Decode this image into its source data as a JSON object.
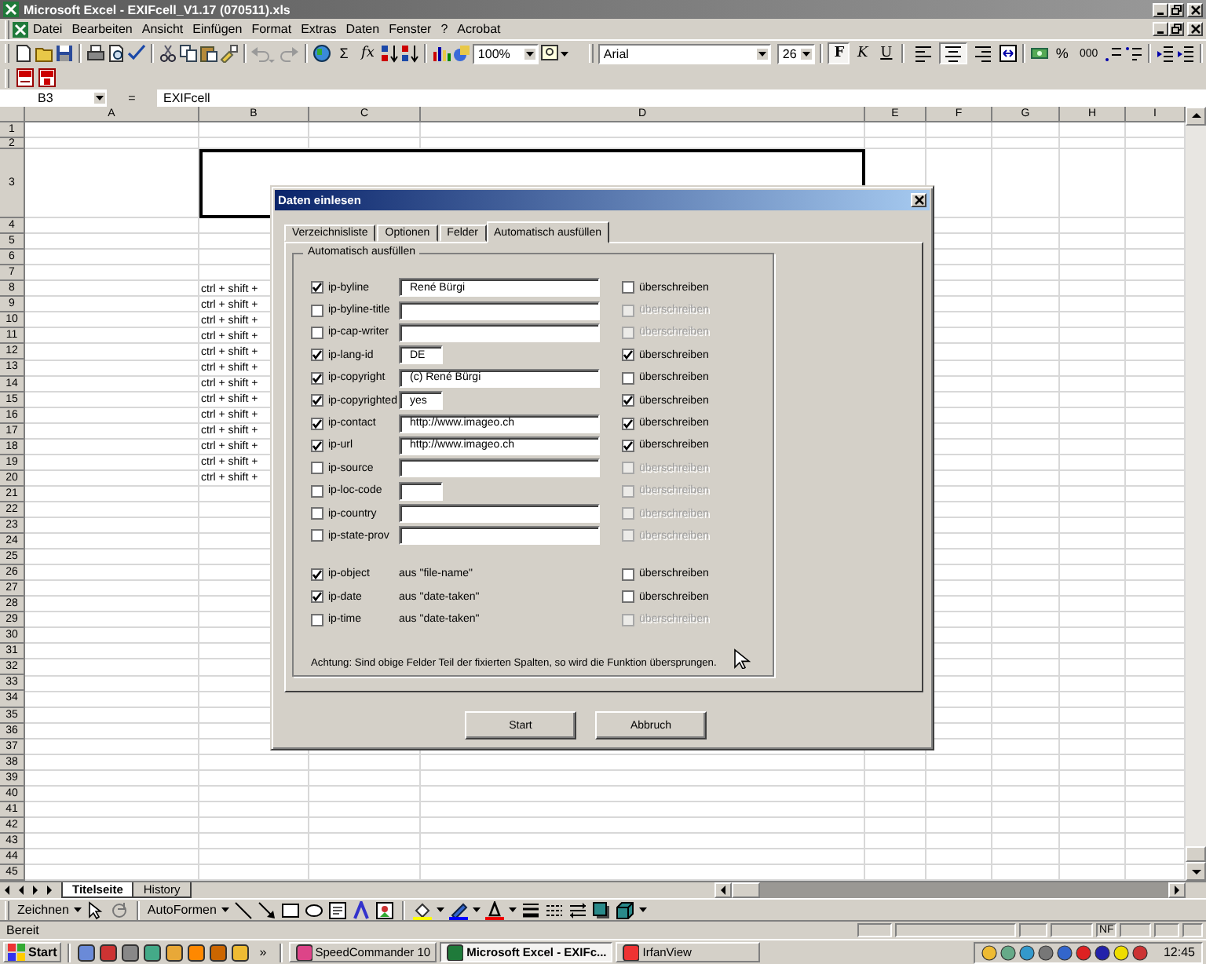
{
  "window": {
    "title": "Microsoft Excel - EXIFcell_V1.17 (070511).xls"
  },
  "menu": [
    "Datei",
    "Bearbeiten",
    "Ansicht",
    "Einfügen",
    "Format",
    "Extras",
    "Daten",
    "Fenster",
    "?",
    "Acrobat"
  ],
  "standard_toolbar": {
    "sum": "Σ",
    "function": "fx",
    "zoom": "100%"
  },
  "formatting_toolbar": {
    "font": "Arial",
    "size": "26",
    "buttons": [
      {
        "label": "F",
        "kind": "bold",
        "pressed": true
      },
      {
        "label": "K",
        "kind": "italic",
        "pressed": false
      },
      {
        "label": "U",
        "kind": "underline",
        "pressed": false
      }
    ],
    "alignment": [
      {
        "kind": "left",
        "pressed": false
      },
      {
        "kind": "center",
        "pressed": true
      },
      {
        "kind": "right",
        "pressed": false
      }
    ],
    "percent": "%",
    "thousands": "000"
  },
  "formula_bar": {
    "name_box": "B3",
    "equals": "=",
    "content": "EXIFcell"
  },
  "columns": [
    "A",
    "B",
    "C",
    "D",
    "E",
    "F",
    "G",
    "H",
    "I"
  ],
  "rows": [
    {
      "label": "1",
      "kind": "normal"
    },
    {
      "label": "2",
      "kind": "short"
    },
    {
      "label": "3",
      "kind": "title"
    },
    {
      "label": "4",
      "kind": "normal"
    },
    {
      "label": "5",
      "kind": "normal"
    },
    {
      "label": "6",
      "kind": "normal"
    },
    {
      "label": "7",
      "kind": "normal"
    },
    {
      "label": "8",
      "kind": "normal",
      "b": "ctrl + shift +"
    },
    {
      "label": "9",
      "kind": "normal",
      "b": "ctrl + shift +"
    },
    {
      "label": "10",
      "kind": "normal",
      "b": "ctrl + shift +"
    },
    {
      "label": "11",
      "kind": "normal",
      "b": "ctrl + shift +"
    },
    {
      "label": "12",
      "kind": "normal",
      "b": "ctrl + shift +"
    },
    {
      "label": "13",
      "kind": "normal",
      "b": "ctrl + shift +"
    },
    {
      "label": "14",
      "kind": "normal",
      "b": "ctrl + shift +"
    },
    {
      "label": "15",
      "kind": "normal",
      "b": "ctrl + shift +"
    },
    {
      "label": "16",
      "kind": "normal",
      "b": "ctrl + shift +"
    },
    {
      "label": "17",
      "kind": "normal",
      "b": "ctrl + shift +"
    },
    {
      "label": "18",
      "kind": "normal",
      "b": "ctrl + shift +"
    },
    {
      "label": "19",
      "kind": "normal",
      "b": "ctrl + shift +"
    },
    {
      "label": "20",
      "kind": "normal",
      "b": "ctrl + shift +"
    },
    {
      "label": "21",
      "kind": "normal"
    },
    {
      "label": "22",
      "kind": "normal"
    },
    {
      "label": "23",
      "kind": "normal"
    },
    {
      "label": "24",
      "kind": "normal"
    },
    {
      "label": "25",
      "kind": "normal"
    },
    {
      "label": "26",
      "kind": "normal"
    },
    {
      "label": "27",
      "kind": "normal"
    },
    {
      "label": "28",
      "kind": "normal"
    },
    {
      "label": "29",
      "kind": "normal"
    },
    {
      "label": "30",
      "kind": "normal"
    },
    {
      "label": "31",
      "kind": "normal"
    },
    {
      "label": "32",
      "kind": "normal"
    },
    {
      "label": "33",
      "kind": "normal"
    },
    {
      "label": "34",
      "kind": "normal"
    },
    {
      "label": "35",
      "kind": "normal"
    },
    {
      "label": "36",
      "kind": "normal"
    },
    {
      "label": "37",
      "kind": "normal"
    },
    {
      "label": "38",
      "kind": "normal"
    },
    {
      "label": "39",
      "kind": "normal"
    },
    {
      "label": "40",
      "kind": "normal"
    },
    {
      "label": "41",
      "kind": "normal"
    },
    {
      "label": "42",
      "kind": "normal"
    },
    {
      "label": "43",
      "kind": "normal"
    },
    {
      "label": "44",
      "kind": "normal"
    },
    {
      "label": "45",
      "kind": "normal"
    }
  ],
  "sheet_tabs": [
    {
      "label": "Titelseite",
      "selected": true
    },
    {
      "label": "History",
      "selected": false
    }
  ],
  "drawing_toolbar": {
    "draw_menu": "Zeichnen",
    "autoshapes": "AutoFormen"
  },
  "status_bar": {
    "status": "Bereit",
    "indicators": [
      "NF"
    ]
  },
  "taskbar": {
    "start": "Start",
    "overflow": "»",
    "tasks": [
      {
        "label": "SpeedCommander 10",
        "selected": false
      },
      {
        "label": "Microsoft Excel - EXIFc...",
        "selected": true
      },
      {
        "label": "IrfanView",
        "selected": false
      }
    ],
    "clock": "12:45"
  },
  "dialog": {
    "title": "Daten einlesen",
    "tabs": [
      {
        "label": "Verzeichnisliste",
        "selected": false
      },
      {
        "label": "Optionen",
        "selected": false
      },
      {
        "label": "Felder",
        "selected": false
      },
      {
        "label": "Automatisch ausfüllen",
        "selected": true
      }
    ],
    "group_title": "Automatisch ausfüllen",
    "fields": [
      {
        "kind": "wide",
        "label": "ip-byline",
        "checked": true,
        "value": "René Bürgi",
        "overwrite_label": "überschreiben",
        "overwrite": false,
        "overwrite_disabled": false
      },
      {
        "kind": "wide",
        "label": "ip-byline-title",
        "checked": false,
        "overwrite_label": "überschreiben",
        "overwrite": false,
        "overwrite_disabled": true
      },
      {
        "kind": "wide",
        "label": "ip-cap-writer",
        "checked": false,
        "overwrite_label": "überschreiben",
        "overwrite": false,
        "overwrite_disabled": true
      },
      {
        "kind": "narrow",
        "label": "ip-lang-id",
        "checked": true,
        "value": "DE",
        "overwrite_label": "überschreiben",
        "overwrite": true,
        "overwrite_disabled": false
      },
      {
        "kind": "wide",
        "label": "ip-copyright",
        "checked": true,
        "value": "(c) René Bürgi",
        "overwrite_label": "überschreiben",
        "overwrite": false,
        "overwrite_disabled": false
      },
      {
        "kind": "narrow",
        "label": "ip-copyrighted",
        "checked": true,
        "value": "yes",
        "overwrite_label": "überschreiben",
        "overwrite": true,
        "overwrite_disabled": false
      },
      {
        "kind": "wide",
        "label": "ip-contact",
        "checked": true,
        "value": "http://www.imageo.ch",
        "overwrite_label": "überschreiben",
        "overwrite": true,
        "overwrite_disabled": false
      },
      {
        "kind": "wide",
        "label": "ip-url",
        "checked": true,
        "value": "http://www.imageo.ch",
        "overwrite_label": "überschreiben",
        "overwrite": true,
        "overwrite_disabled": false
      },
      {
        "kind": "wide",
        "label": "ip-source",
        "checked": false,
        "overwrite_label": "überschreiben",
        "overwrite": false,
        "overwrite_disabled": true
      },
      {
        "kind": "narrow",
        "label": "ip-loc-code",
        "checked": false,
        "overwrite_label": "überschreiben",
        "overwrite": false,
        "overwrite_disabled": true
      },
      {
        "kind": "wide",
        "label": "ip-country",
        "checked": false,
        "overwrite_label": "überschreiben",
        "overwrite": false,
        "overwrite_disabled": true
      },
      {
        "kind": "wide",
        "label": "ip-state-prov",
        "checked": false,
        "overwrite_label": "überschreiben",
        "overwrite": false,
        "overwrite_disabled": true
      },
      {
        "kind": "source",
        "label": "ip-object",
        "checked": true,
        "source": "aus \"file-name\"",
        "overwrite_label": "überschreiben",
        "overwrite": false,
        "overwrite_disabled": false
      },
      {
        "kind": "source",
        "label": "ip-date",
        "checked": true,
        "source": "aus \"date-taken\"",
        "overwrite_label": "überschreiben",
        "overwrite": false,
        "overwrite_disabled": false
      },
      {
        "kind": "source",
        "label": "ip-time",
        "checked": false,
        "source": "aus \"date-taken\"",
        "overwrite_label": "überschreiben",
        "overwrite": false,
        "overwrite_disabled": true
      }
    ],
    "note": "Achtung:  Sind obige Felder Teil der fixierten Spalten, so wird die Funktion übersprungen.",
    "buttons": [
      "Start",
      "Abbruch"
    ]
  }
}
